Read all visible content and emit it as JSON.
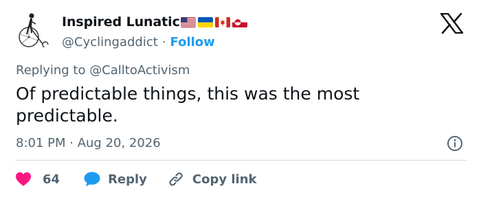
{
  "author": {
    "display_name": "Inspired Lunatic",
    "handle": "@Cyclingaddict",
    "separator": "·",
    "follow_label": "Follow",
    "avatar_icon": "penny-farthing-icon",
    "flags": [
      "us-flag-icon",
      "ukraine-flag-icon",
      "canada-flag-icon",
      "greenland-flag-icon"
    ]
  },
  "brand_icon": "x-logo-icon",
  "reply_to": {
    "prefix": "Replying to ",
    "handle": "@CalltoActivism"
  },
  "body": "Of predictable things, this was the most predictable.",
  "meta": {
    "time": "8:01 PM",
    "separator": " · ",
    "date": "Aug 20, 2026",
    "info_icon": "info-icon"
  },
  "actions": {
    "like_count": "64",
    "reply_label": "Reply",
    "copy_link_label": "Copy link"
  },
  "colors": {
    "text": "#0f1419",
    "secondary": "#536471",
    "link": "#1d9bf0",
    "heart": "#f91880",
    "divider": "#cfd9de"
  }
}
